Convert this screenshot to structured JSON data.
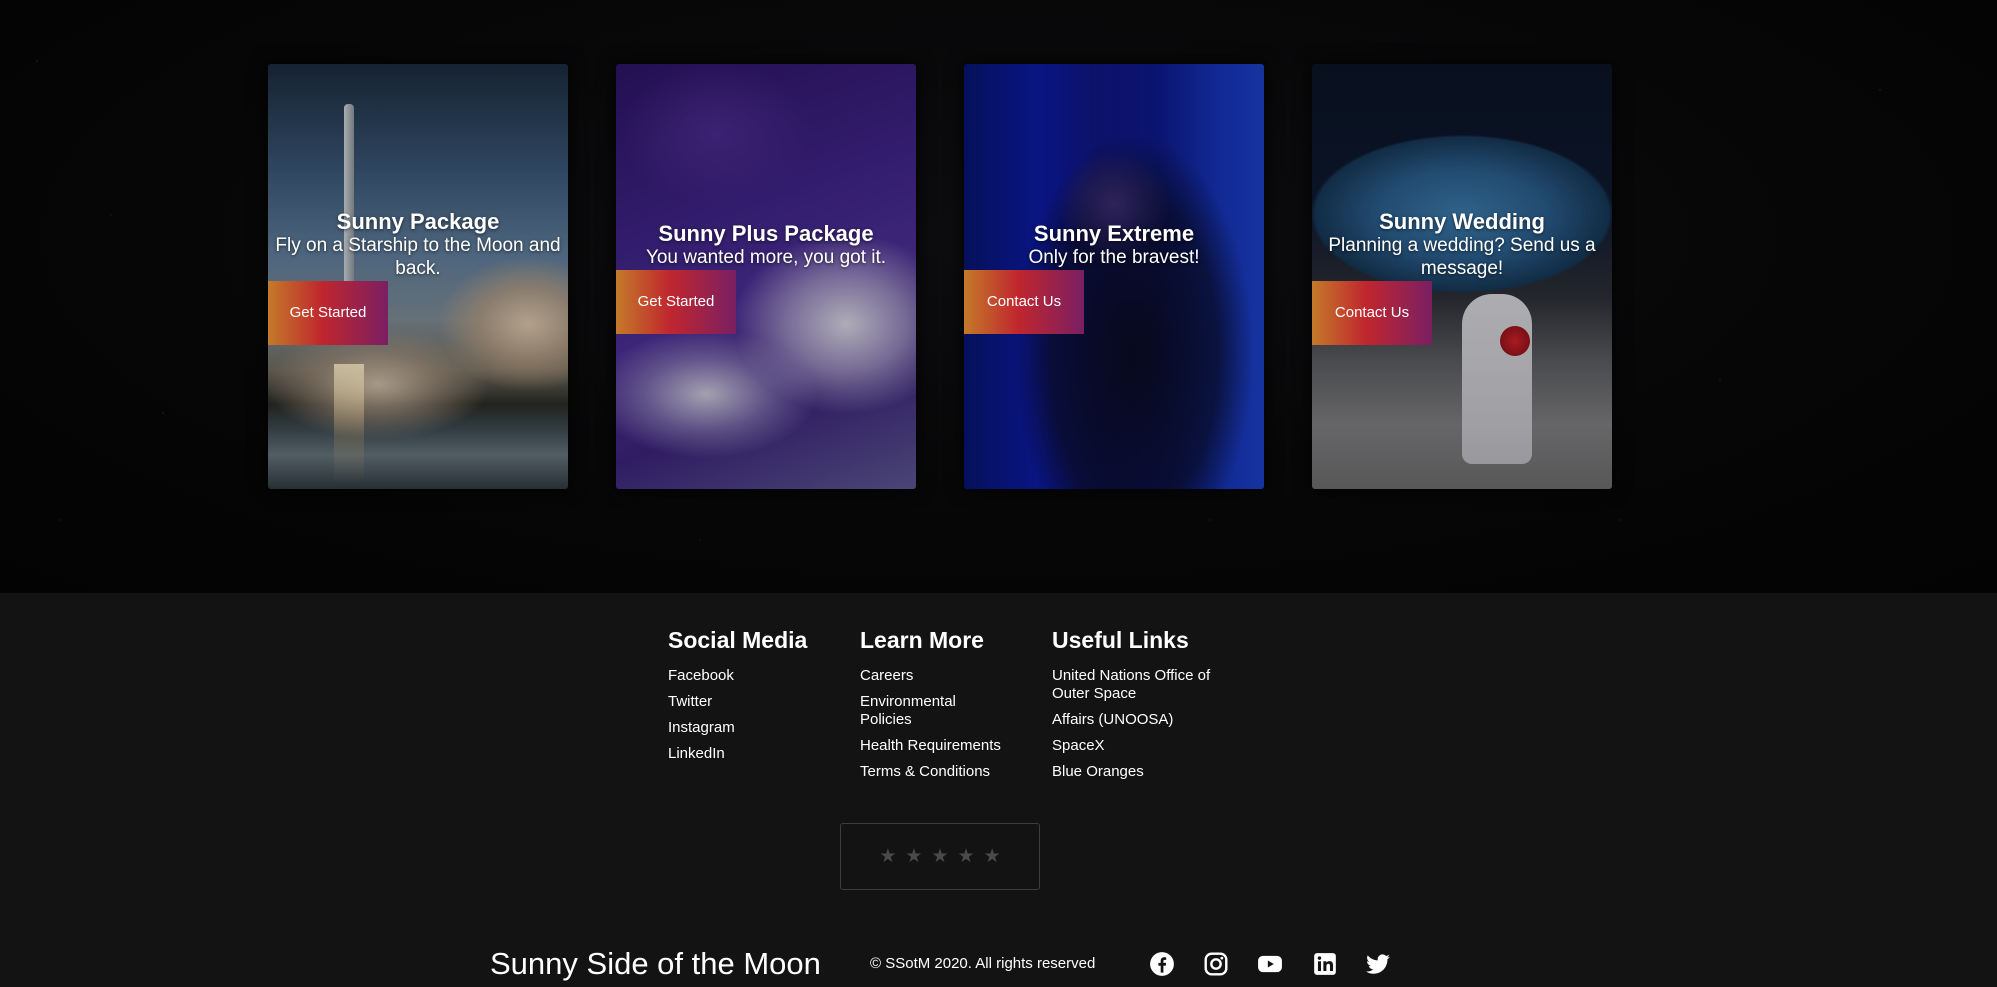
{
  "cards": [
    {
      "title": "Sunny Package",
      "subtitle": "Fly on a Starship to the Moon and back.",
      "button": "Get Started"
    },
    {
      "title": "Sunny Plus Package",
      "subtitle": "You wanted more, you got it.",
      "button": "Get Started"
    },
    {
      "title": "Sunny Extreme",
      "subtitle": "Only for the bravest!",
      "button": "Contact Us"
    },
    {
      "title": "Sunny Wedding",
      "subtitle": "Planning a wedding? Send us a message!",
      "button": "Contact Us"
    }
  ],
  "footer": {
    "social_media": {
      "heading": "Social Media",
      "links": [
        "Facebook",
        "Twitter",
        "Instagram",
        "LinkedIn"
      ]
    },
    "learn_more": {
      "heading": "Learn More",
      "links": [
        "Careers",
        "Environmental Policies",
        "Health Requirements",
        "Terms & Conditions"
      ]
    },
    "useful_links": {
      "heading": "Useful Links",
      "links": [
        "United Nations Office of Outer Space",
        "Affairs (UNOOSA)",
        "SpaceX",
        "Blue Oranges"
      ]
    },
    "rating": {
      "stars": 5,
      "filled": 0
    },
    "brand": "Sunny Side of the Moon",
    "copyright": "© SSotM 2020. All rights reserved",
    "social_icons": [
      "facebook-icon",
      "instagram-icon",
      "youtube-icon",
      "linkedin-icon",
      "twitter-icon"
    ]
  },
  "colors": {
    "button_gradient_start": "#c47a2a",
    "button_gradient_mid": "#c0262e",
    "button_gradient_end": "#7a1f63",
    "footer_bg": "#131313",
    "star_inactive": "#4a4a4a"
  }
}
